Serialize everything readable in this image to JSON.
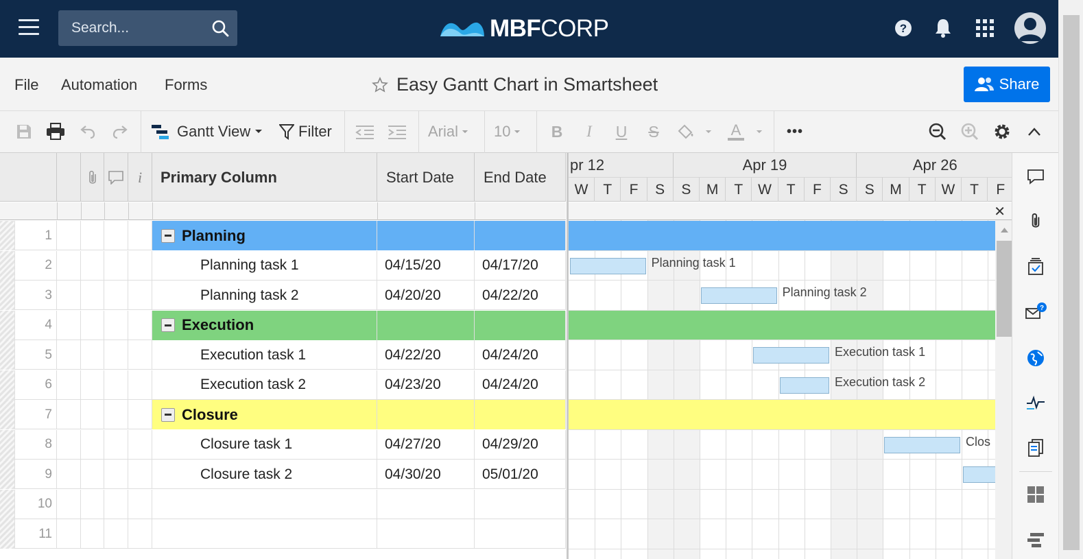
{
  "nav": {
    "search_placeholder": "Search...",
    "logo_bold": "MBF",
    "logo_thin": "CORP",
    "icons": [
      "help-icon",
      "bell-icon",
      "apps-grid-icon",
      "user-avatar-icon"
    ]
  },
  "titlebar": {
    "menu": [
      "File",
      "Automation",
      "Forms"
    ],
    "sheet_title": "Easy Gantt Chart in Smartsheet",
    "share_label": "Share"
  },
  "toolbar": {
    "view_label": "Gantt View",
    "filter_label": "Filter",
    "font_family": "Arial",
    "font_size": "10",
    "more_label": "•••"
  },
  "grid": {
    "headers": {
      "primary": "Primary Column",
      "start": "Start Date",
      "end": "End Date",
      "info": "i"
    },
    "rows": [
      {
        "num": "1",
        "name": "Planning",
        "start": "",
        "end": "",
        "parent": true,
        "color": "#62b0f5"
      },
      {
        "num": "2",
        "name": "Planning task 1",
        "start": "04/15/20",
        "end": "04/17/20"
      },
      {
        "num": "3",
        "name": "Planning task 2",
        "start": "04/20/20",
        "end": "04/22/20"
      },
      {
        "num": "4",
        "name": "Execution",
        "start": "",
        "end": "",
        "parent": true,
        "color": "#7fd37f"
      },
      {
        "num": "5",
        "name": "Execution task 1",
        "start": "04/22/20",
        "end": "04/24/20"
      },
      {
        "num": "6",
        "name": "Execution task 2",
        "start": "04/23/20",
        "end": "04/24/20"
      },
      {
        "num": "7",
        "name": "Closure",
        "start": "",
        "end": "",
        "parent": true,
        "color": "#fffe80"
      },
      {
        "num": "8",
        "name": "Closure task 1",
        "start": "04/27/20",
        "end": "04/29/20"
      },
      {
        "num": "9",
        "name": "Closure task 2",
        "start": "04/30/20",
        "end": "05/01/20"
      },
      {
        "num": "10",
        "name": "",
        "start": "",
        "end": ""
      },
      {
        "num": "11",
        "name": "",
        "start": "",
        "end": ""
      }
    ]
  },
  "gantt": {
    "weeks": [
      "pr 12",
      "Apr 19",
      "Apr 26"
    ],
    "days": [
      "W",
      "T",
      "F",
      "S",
      "S",
      "M",
      "T",
      "W",
      "T",
      "F",
      "S",
      "S",
      "M",
      "T",
      "W",
      "T",
      "F"
    ],
    "close_label": "✕",
    "bars": [
      {
        "row": 2,
        "label": "Planning task 1"
      },
      {
        "row": 3,
        "label": "Planning task 2"
      },
      {
        "row": 5,
        "label": "Execution task 1"
      },
      {
        "row": 6,
        "label": "Execution task 2"
      },
      {
        "row": 8,
        "label": "Clos"
      },
      {
        "row": 9,
        "label": ""
      }
    ]
  },
  "rail": {
    "icons": [
      "comment-icon",
      "attachment-icon",
      "proofing-icon",
      "update-request-icon",
      "publish-icon",
      "activity-log-icon",
      "summary-icon",
      "dashboard-icon",
      "integrations-icon"
    ],
    "badge": "?"
  }
}
